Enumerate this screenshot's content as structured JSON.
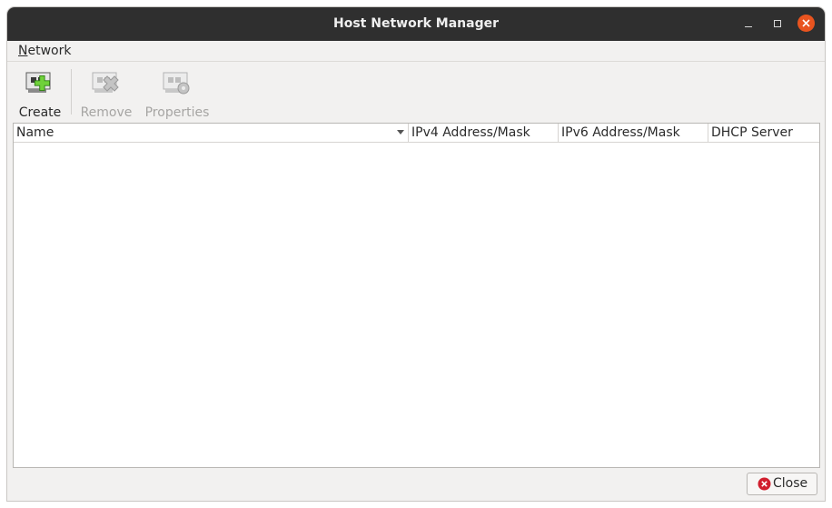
{
  "window": {
    "title": "Host Network Manager"
  },
  "menubar": {
    "items": [
      {
        "label_mnemonic": "N",
        "label_rest": "etwork"
      }
    ]
  },
  "toolbar": {
    "create_label": "Create",
    "remove_label": "Remove",
    "properties_label": "Properties"
  },
  "table": {
    "columns": [
      "Name",
      "IPv4 Address/Mask",
      "IPv6 Address/Mask",
      "DHCP Server"
    ],
    "rows": []
  },
  "footer": {
    "close_label": "Close"
  },
  "colors": {
    "titlebar": "#2f2f2f",
    "close_accent": "#e9541f",
    "create_icon": "#6fd13a"
  }
}
